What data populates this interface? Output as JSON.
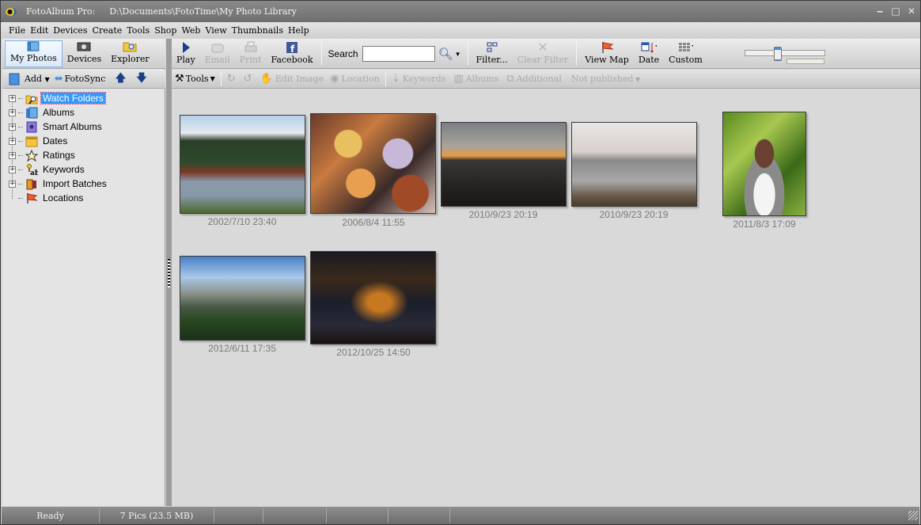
{
  "window": {
    "app_name": "FotoAlbum Pro:",
    "path": "D:\\Documents\\FotoTime\\My Photo Library",
    "controls": {
      "minimize": "‒",
      "maximize": "□",
      "close": "✕"
    }
  },
  "menu": [
    "File",
    "Edit",
    "Devices",
    "Create",
    "Tools",
    "Shop",
    "Web",
    "View",
    "Thumbnails",
    "Help"
  ],
  "left_toolbar": {
    "views": [
      {
        "label": "My Photos",
        "icon": "my-photos-icon",
        "active": true
      },
      {
        "label": "Devices",
        "icon": "camera-icon",
        "active": false
      },
      {
        "label": "Explorer",
        "icon": "folder-search-icon",
        "active": false
      }
    ],
    "add_label": "Add",
    "fotosync_label": "FotoSync"
  },
  "tree": [
    {
      "label": "Watch Folders",
      "icon": "watch-folder-icon",
      "expandable": true,
      "selected": true
    },
    {
      "label": "Albums",
      "icon": "albums-icon",
      "expandable": true,
      "selected": false
    },
    {
      "label": "Smart Albums",
      "icon": "smart-album-icon",
      "expandable": true,
      "selected": false
    },
    {
      "label": "Dates",
      "icon": "calendar-icon",
      "expandable": true,
      "selected": false
    },
    {
      "label": "Ratings",
      "icon": "star-icon",
      "expandable": true,
      "selected": false
    },
    {
      "label": "Keywords",
      "icon": "keyword-icon",
      "expandable": true,
      "selected": false
    },
    {
      "label": "Import Batches",
      "icon": "film-roll-icon",
      "expandable": true,
      "selected": false
    },
    {
      "label": "Locations",
      "icon": "flag-icon",
      "expandable": false,
      "selected": false
    }
  ],
  "toolbar": {
    "play": "Play",
    "email": "Email",
    "print": "Print",
    "facebook": "Facebook",
    "search_label": "Search",
    "search_value": "",
    "filter": "Filter...",
    "clear_filter": "Clear Filter",
    "view_map": "View Map",
    "date": "Date",
    "custom": "Custom",
    "thumbnail_size_fraction": 0.4
  },
  "toolbar2": {
    "tools": "Tools",
    "edit_image": "Edit Image",
    "location": "Location",
    "keywords": "Keywords",
    "albums": "Albums",
    "additional": "Additional",
    "not_published": "Not published"
  },
  "photos": [
    {
      "caption": "2002/7/10  23:40",
      "subject": "mountain-river"
    },
    {
      "caption": "2006/8/4  11:55",
      "subject": "autumn-leaves"
    },
    {
      "caption": "2010/9/23  20:19",
      "subject": "sunset-sea"
    },
    {
      "caption": "2010/9/23  20:19",
      "subject": "misty-sea"
    },
    {
      "caption": "2011/8/3  17:09",
      "subject": "portrait-woman"
    },
    {
      "caption": "2012/6/11  17:35",
      "subject": "valley-cliffs"
    },
    {
      "caption": "2012/10/25  14:50",
      "subject": "city-night"
    }
  ],
  "status": {
    "state": "Ready",
    "count": "7 Pics (23.5 MB)"
  }
}
